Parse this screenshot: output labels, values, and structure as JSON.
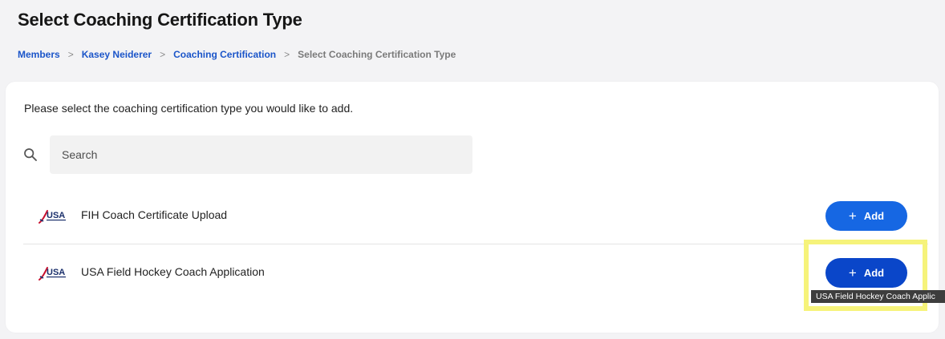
{
  "page": {
    "title": "Select Coaching Certification Type"
  },
  "breadcrumb": {
    "items": [
      {
        "label": "Members"
      },
      {
        "label": "Kasey Neiderer"
      },
      {
        "label": "Coaching Certification"
      }
    ],
    "separator": ">",
    "current": "Select Coaching Certification Type"
  },
  "card": {
    "intro": "Please select the coaching certification type you would like to add."
  },
  "search": {
    "placeholder": "Search",
    "value": ""
  },
  "certifications": [
    {
      "name": "FIH Coach Certificate Upload",
      "logo_text": "USA",
      "button_label": "Add",
      "button_icon": "plus-icon"
    },
    {
      "name": "USA Field Hockey Coach Application",
      "logo_text": "USA",
      "button_label": "Add",
      "button_icon": "plus-icon"
    }
  ],
  "tooltip": {
    "text": "USA Field Hockey Coach Applic"
  },
  "colors": {
    "accent": "#1667e3",
    "accent_hover": "#0a46c9",
    "link": "#1b55c9",
    "highlight": "#f6f37a"
  }
}
